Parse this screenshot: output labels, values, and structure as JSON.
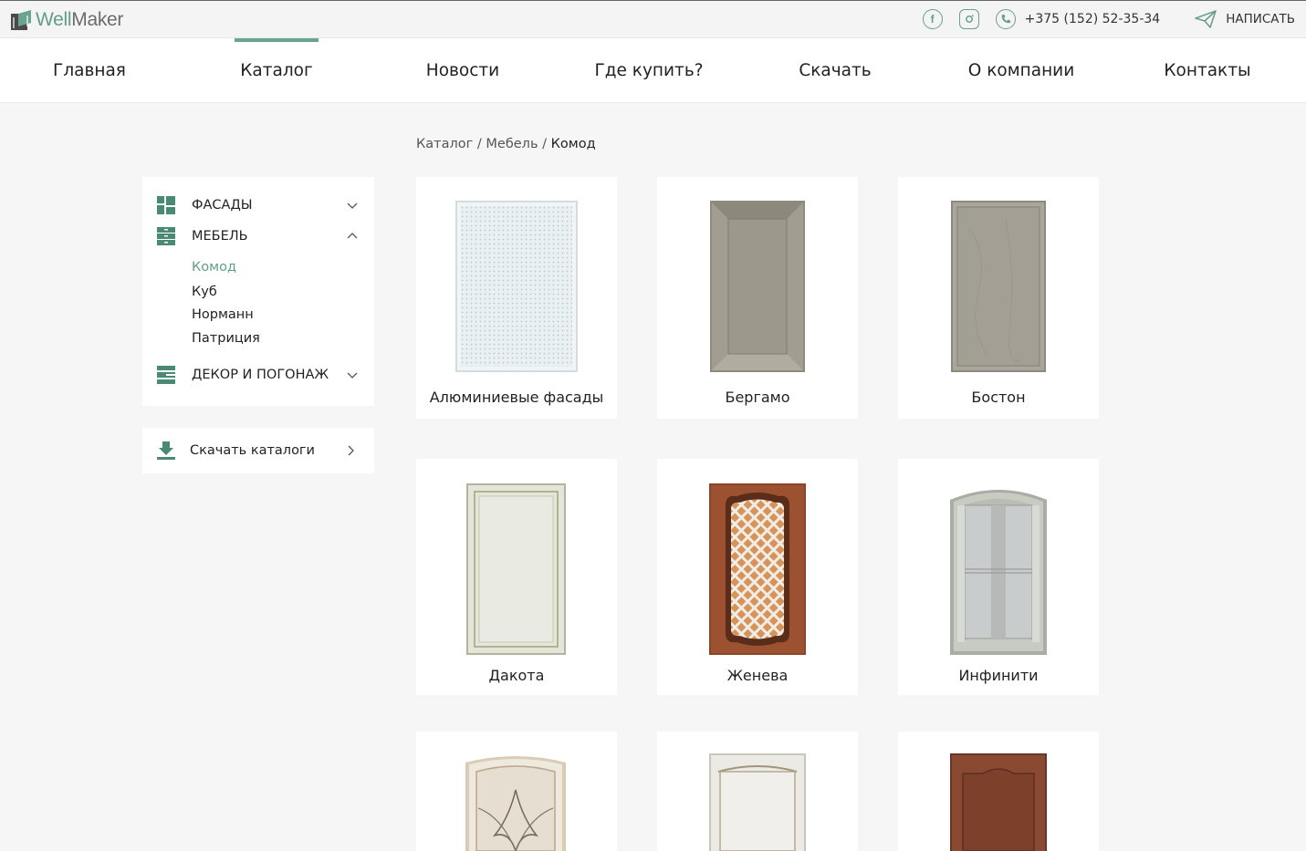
{
  "brand": {
    "part1": "Well",
    "part2": "Maker"
  },
  "topbar": {
    "facebook_icon": "facebook-icon",
    "instagram_icon": "instagram-icon",
    "phone": "+375 (152) 52-35-34",
    "write_label": "НАПИСАТЬ"
  },
  "nav": {
    "items": [
      "Главная",
      "Каталог",
      "Новости",
      "Где купить?",
      "Скачать",
      "О компании",
      "Контакты"
    ],
    "active": "Каталог"
  },
  "breadcrumb": {
    "items": [
      "Каталог",
      "Мебель"
    ],
    "current": "Комод",
    "sep": " / "
  },
  "sidebar": {
    "categories": [
      {
        "label": "ФАСАДЫ",
        "icon": "facades-icon",
        "expanded": false
      },
      {
        "label": "МЕБЕЛЬ",
        "icon": "furniture-icon",
        "expanded": true
      },
      {
        "label": "ДЕКОР И ПОГОНАЖ",
        "icon": "decor-icon",
        "expanded": false
      }
    ],
    "subitems": [
      "Комод",
      "Куб",
      "Норманн",
      "Патриция"
    ],
    "active_sub": "Комод",
    "download_label": "Скачать каталоги"
  },
  "products": [
    {
      "title": "Алюминиевые фасады"
    },
    {
      "title": "Бергамо"
    },
    {
      "title": "Бостон"
    },
    {
      "title": "Дакота"
    },
    {
      "title": "Женева"
    },
    {
      "title": "Инфинити"
    },
    {
      "title": ""
    },
    {
      "title": ""
    },
    {
      "title": ""
    }
  ],
  "colors": {
    "accent": "#6aa391",
    "brand": "#5f9e8a"
  }
}
